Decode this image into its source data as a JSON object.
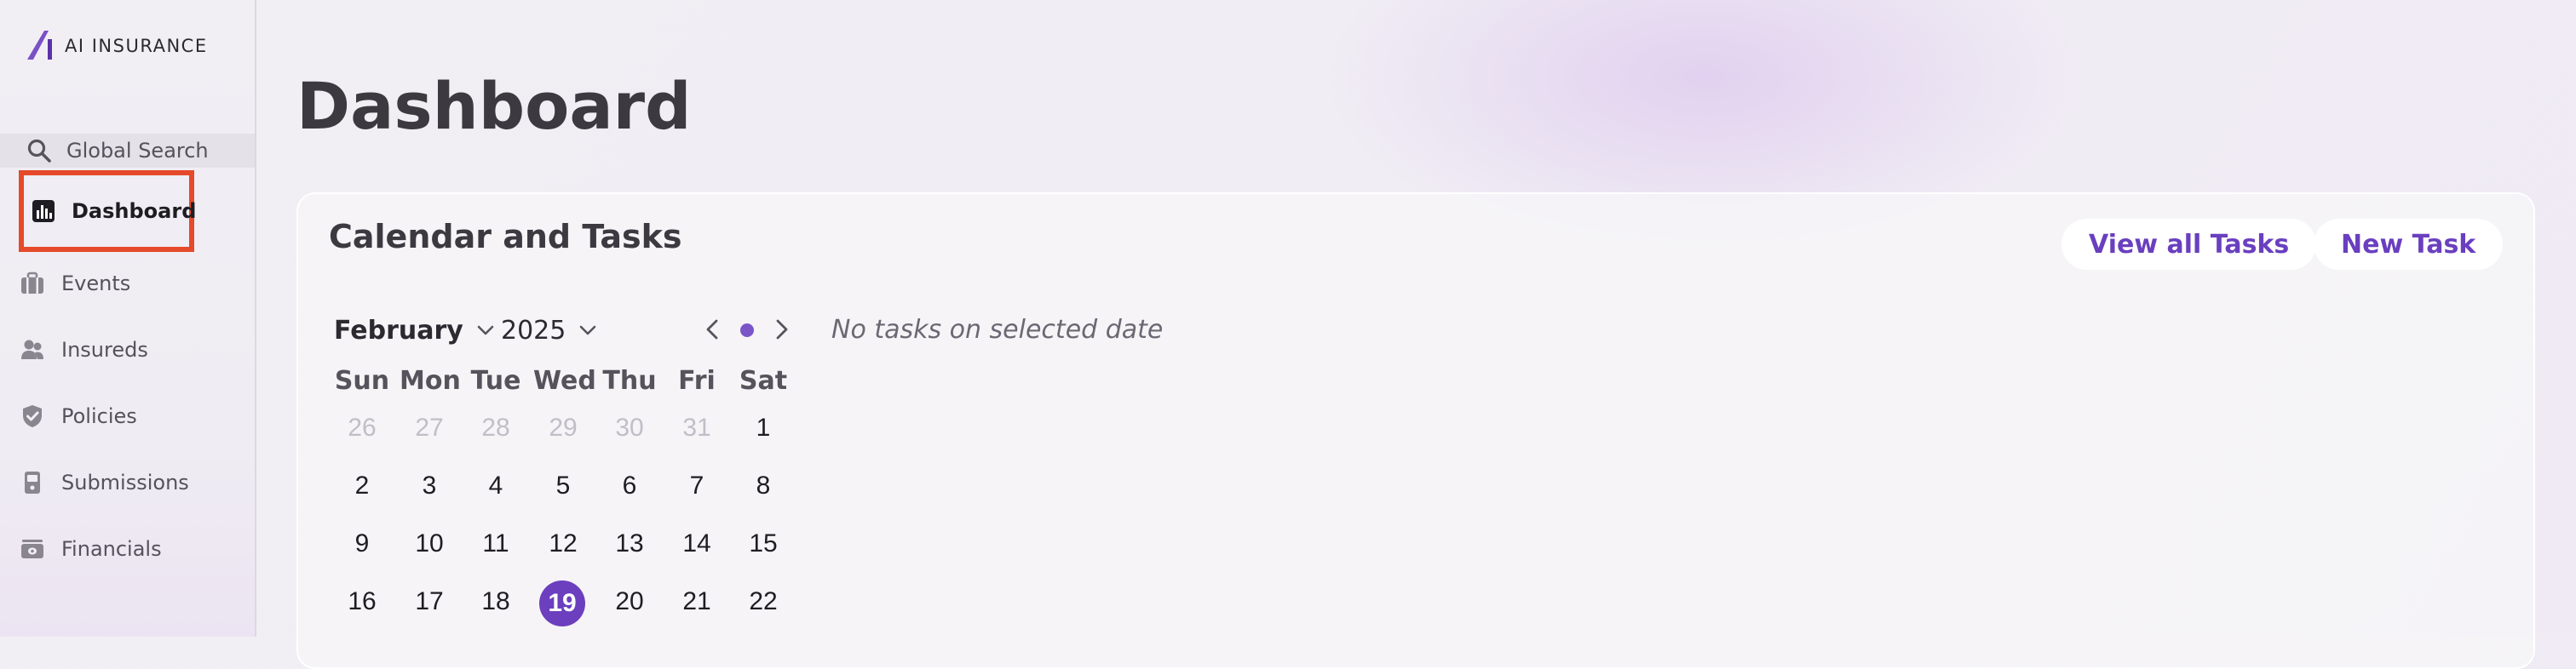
{
  "app": {
    "brand": "AI INSURANCE"
  },
  "sidebar": {
    "search_label": "Global Search",
    "items": [
      {
        "label": "Dashboard",
        "icon": "bar-chart-icon",
        "active": true
      },
      {
        "label": "Events",
        "icon": "briefcase-icon"
      },
      {
        "label": "Insureds",
        "icon": "people-icon"
      },
      {
        "label": "Policies",
        "icon": "shield-icon"
      },
      {
        "label": "Submissions",
        "icon": "device-icon"
      },
      {
        "label": "Financials",
        "icon": "money-icon"
      }
    ]
  },
  "main": {
    "title": "Dashboard",
    "calendar_card": {
      "title": "Calendar and Tasks",
      "view_all_label": "View all Tasks",
      "new_task_label": "New Task",
      "month": "February",
      "year": "2025",
      "empty_message": "No tasks on selected date",
      "weekdays": [
        "Sun",
        "Mon",
        "Tue",
        "Wed",
        "Thu",
        "Fri",
        "Sat"
      ],
      "weeks": [
        [
          "26",
          "27",
          "28",
          "29",
          "30",
          "31",
          "1"
        ],
        [
          "2",
          "3",
          "4",
          "5",
          "6",
          "7",
          "8"
        ],
        [
          "9",
          "10",
          "11",
          "12",
          "13",
          "14",
          "15"
        ],
        [
          "16",
          "17",
          "18",
          "19",
          "20",
          "21",
          "22"
        ]
      ],
      "selected_day": "19"
    }
  },
  "colors": {
    "accent": "#6b3fbe",
    "highlight_border": "#e54a2a",
    "muted_day": "#c2bec8"
  }
}
